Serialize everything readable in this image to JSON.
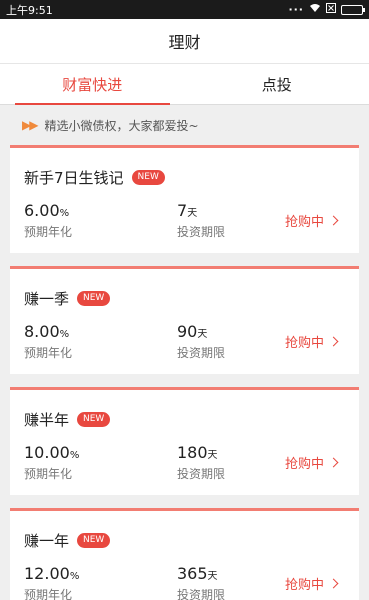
{
  "status": {
    "time": "上午9:51",
    "dots": "···"
  },
  "header": {
    "title": "理财"
  },
  "tabs": [
    {
      "label": "财富快进",
      "active": true
    },
    {
      "label": "点投",
      "active": false
    }
  ],
  "notice": {
    "text": "精选小微债权，大家都爱投~"
  },
  "products": [
    {
      "name": "新手7日生钱记",
      "badge": "NEW",
      "rate": "6.00",
      "rate_unit": "%",
      "rate_label": "预期年化",
      "term": "7",
      "term_unit": "天",
      "term_label": "投资期限",
      "action": "抢购中"
    },
    {
      "name": "赚一季",
      "badge": "NEW",
      "rate": "8.00",
      "rate_unit": "%",
      "rate_label": "预期年化",
      "term": "90",
      "term_unit": "天",
      "term_label": "投资期限",
      "action": "抢购中"
    },
    {
      "name": "赚半年",
      "badge": "NEW",
      "rate": "10.00",
      "rate_unit": "%",
      "rate_label": "预期年化",
      "term": "180",
      "term_unit": "天",
      "term_label": "投资期限",
      "action": "抢购中"
    },
    {
      "name": "赚一年",
      "badge": "NEW",
      "rate": "12.00",
      "rate_unit": "%",
      "rate_label": "预期年化",
      "term": "365",
      "term_unit": "天",
      "term_label": "投资期限",
      "action": "抢购中"
    }
  ],
  "colors": {
    "accent": "#e8483f",
    "card_border": "#f27d72"
  }
}
